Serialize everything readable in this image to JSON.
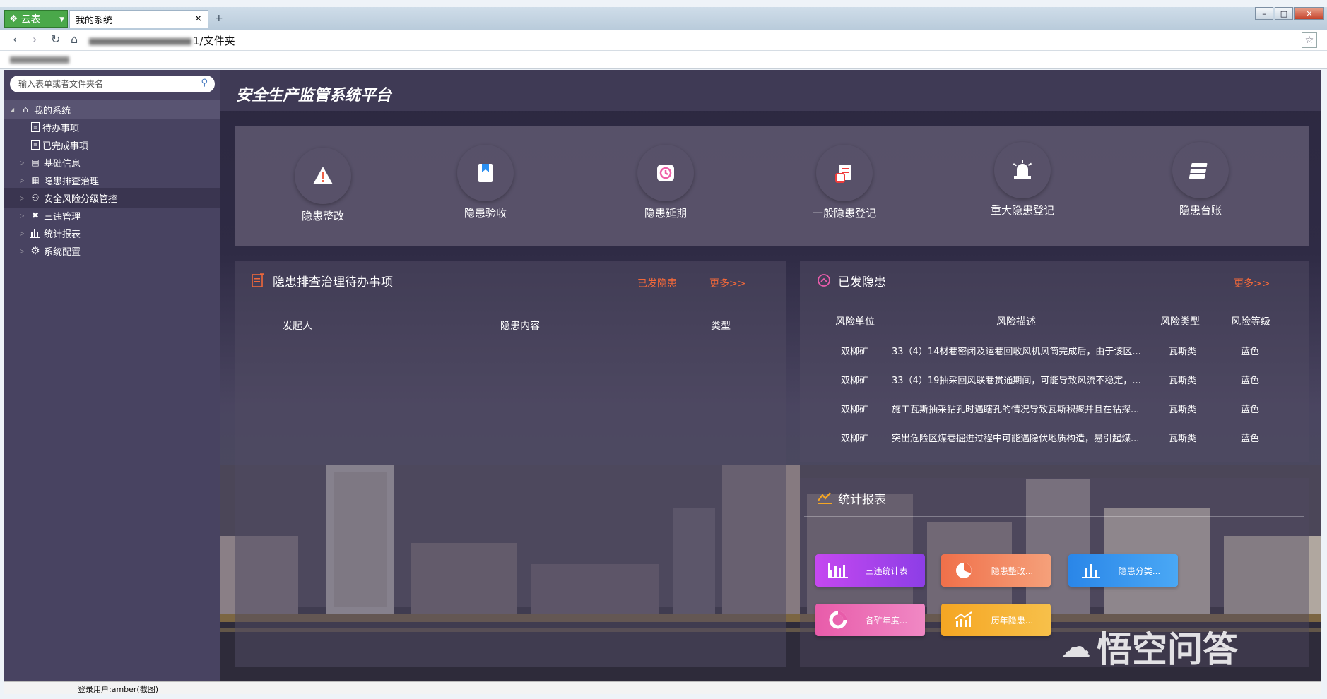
{
  "browser": {
    "app_tab_label": "云表",
    "active_tab_title": "我的系统",
    "tab_close": "×",
    "new_tab": "+",
    "address_suffix": "1/文件夹"
  },
  "sidebar": {
    "search_placeholder": "输入表单或者文件夹名",
    "root_label": "我的系统",
    "items": [
      {
        "label": "待办事项",
        "icon": "list-icon"
      },
      {
        "label": "已完成事项",
        "icon": "list-icon"
      },
      {
        "label": "基础信息",
        "icon": "id-card-icon"
      },
      {
        "label": "隐患排查治理",
        "icon": "inspect-icon"
      },
      {
        "label": "安全风险分级管控",
        "icon": "users-icon"
      },
      {
        "label": "三违管理",
        "icon": "tools-icon"
      },
      {
        "label": "统计报表",
        "icon": "bar-chart-icon"
      },
      {
        "label": "系统配置",
        "icon": "gear-icon"
      }
    ]
  },
  "header": {
    "title": "安全生产监管系统平台"
  },
  "quick_actions": [
    {
      "label": "隐患整改",
      "color": "#ef6248",
      "icon": "warning-edit-icon"
    },
    {
      "label": "隐患验收",
      "color": "#2a8ef0",
      "icon": "book-icon"
    },
    {
      "label": "隐患延期",
      "color": "#ee5fa8",
      "icon": "clock-icon"
    },
    {
      "label": "一般隐患登记",
      "color": "#ee3c3c",
      "icon": "doc-register-icon"
    },
    {
      "label": "重大隐患登记",
      "color": "#f6a623",
      "icon": "alarm-icon"
    },
    {
      "label": "隐患台账",
      "color": "#b04de8",
      "icon": "ledger-icon"
    }
  ],
  "todo_panel": {
    "title": "隐患排查治理待办事项",
    "link_issued": "已发隐患",
    "link_more": "更多>>",
    "columns": [
      "发起人",
      "隐患内容",
      "类型"
    ]
  },
  "issued_panel": {
    "title": "已发隐患",
    "link_more": "更多>>",
    "columns": [
      "风险单位",
      "风险描述",
      "风险类型",
      "风险等级"
    ],
    "rows": [
      [
        "双柳矿",
        "33（4）14材巷密闭及运巷回收风机风筒完成后，由于该区...",
        "瓦斯类",
        "蓝色"
      ],
      [
        "双柳矿",
        "33（4）19抽采回风联巷贯通期间，可能导致风流不稳定，...",
        "瓦斯类",
        "蓝色"
      ],
      [
        "双柳矿",
        "施工瓦斯抽采钻孔时遇瞎孔的情况导致瓦斯积聚并且在钻探...",
        "瓦斯类",
        "蓝色"
      ],
      [
        "双柳矿",
        "突出危险区煤巷掘进过程中可能遇隐伏地质构造，易引起煤...",
        "瓦斯类",
        "蓝色"
      ]
    ]
  },
  "report_panel": {
    "title": "统计报表",
    "buttons": [
      {
        "label": "三违统计表",
        "color1": "#c548f0",
        "color2": "#8d3ee6"
      },
      {
        "label": "隐患整改...",
        "color1": "#f0704a",
        "color2": "#f5a07a"
      },
      {
        "label": "隐患分类...",
        "color1": "#2a86e8",
        "color2": "#4aa8f5"
      },
      {
        "label": "各矿年度...",
        "color1": "#e85caa",
        "color2": "#f088c4"
      },
      {
        "label": "历年隐患...",
        "color1": "#f5a623",
        "color2": "#f7c04a"
      }
    ]
  },
  "status": {
    "user": "登录用户:amber(截图)"
  },
  "watermark": {
    "text": "悟空问答"
  },
  "colors": {
    "accent_orange": "#f0683a",
    "sidebar_bg": "#484361",
    "main_bg": "#2f2b45"
  }
}
